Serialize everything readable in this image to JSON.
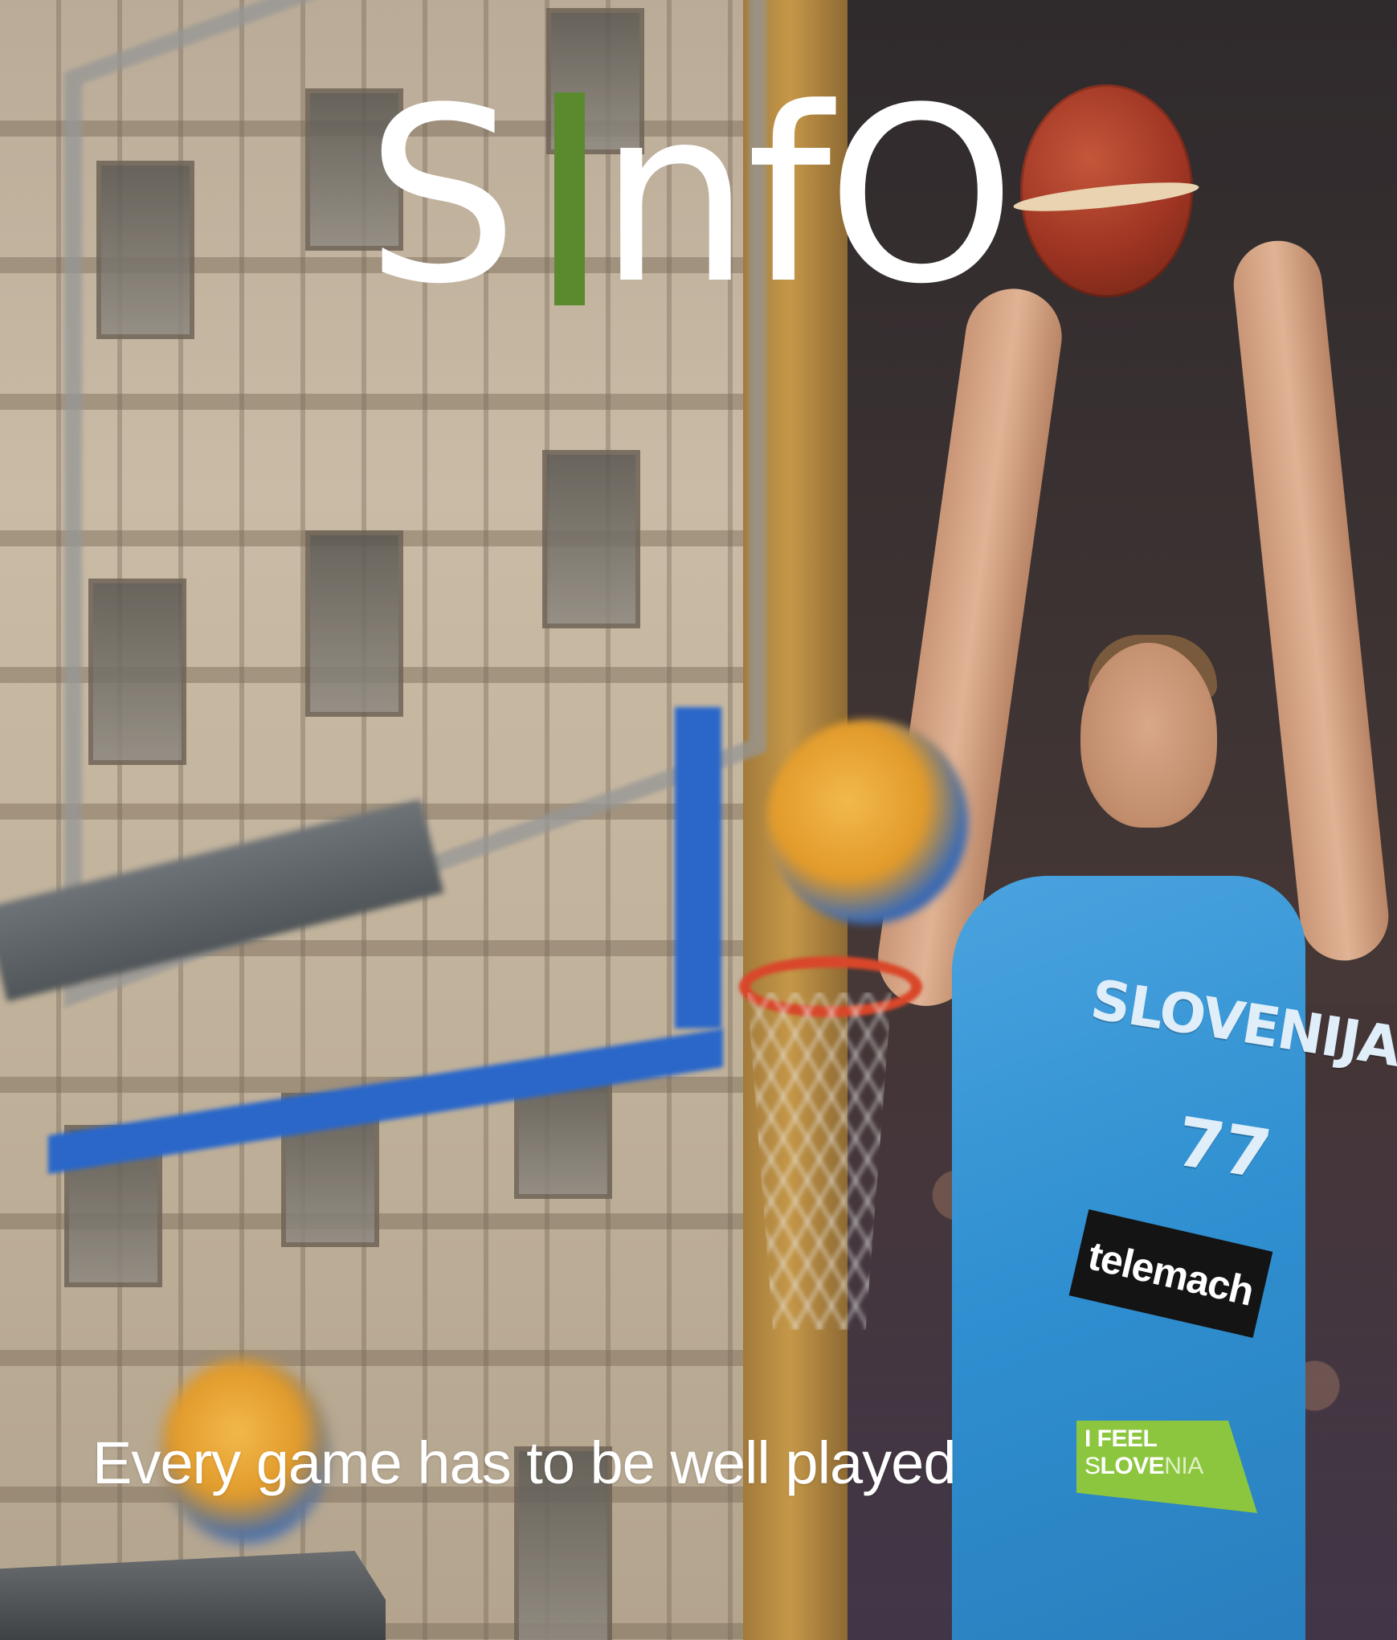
{
  "cover": {
    "logo": {
      "part1": "S",
      "part2": "nfO",
      "i_color": "#5b8a2e"
    },
    "tagline": "Every game has to be well played",
    "badge": {
      "line1": "I FEEL",
      "line2_a": "S",
      "line2_b": "LOVE",
      "line2_c": "NIA",
      "color": "#8cc63f"
    },
    "photo": {
      "jersey_text": "SLOVENIJA",
      "jersey_number": "77",
      "sponsor": "telemach"
    }
  }
}
